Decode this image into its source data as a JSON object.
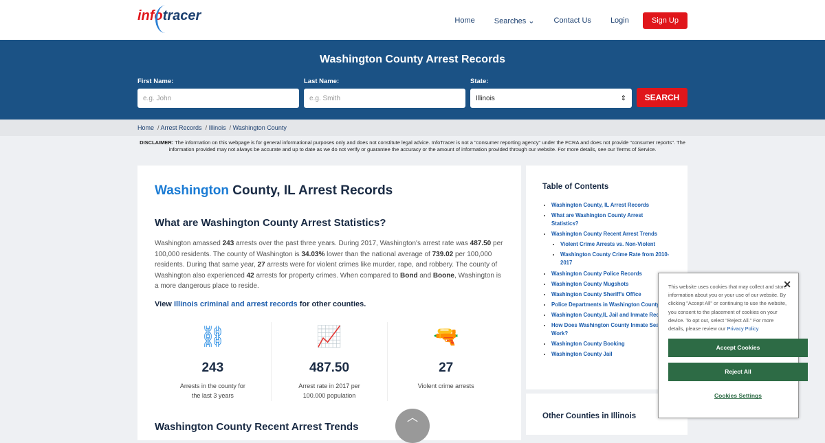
{
  "header": {
    "logo": "infotracer",
    "nav": [
      "Home",
      "Searches",
      "Contact Us",
      "Login"
    ],
    "signup": "Sign Up"
  },
  "hero": {
    "title": "Washington County Arrest Records",
    "first_label": "First Name:",
    "first_placeholder": "e.g. John",
    "last_label": "Last Name:",
    "last_placeholder": "e.g. Smith",
    "state_label": "State:",
    "state_value": "Illinois",
    "search": "SEARCH"
  },
  "breadcrumb": [
    "Home",
    "Arrest Records",
    "Illinois",
    "Washington County"
  ],
  "disclaimer": {
    "label": "DISCLAIMER:",
    "text": " The information on this webpage is for general informational purposes only and does not constitute legal advice. InfoTracer is not a \"consumer reporting agency\" under the FCRA and does not provide \"consumer reports\". The information provided may not always be accurate and up to date as we do not verify or guarantee the accuracy or the amount of information provided through our website. For more details, see our ",
    "link": "Terms of Service",
    "end": "."
  },
  "main": {
    "title_a": "Washington",
    "title_b": " County, IL Arrest Records",
    "h3": "What are Washington County Arrest Statistics?",
    "p": [
      "Washington amassed ",
      "243",
      " arrests over the past three years. During 2017, Washington's arrest rate was ",
      "487.50",
      " per 100,000 residents. The county of Washington is ",
      "34.03%",
      " lower than the national average of ",
      "739.02",
      " per 100,000 residents. During that same year, ",
      "27",
      " arrests were for violent crimes like murder, rape, and robbery. The county of Washington also experienced ",
      "42",
      " arrests for property crimes. When compared to ",
      "Bond",
      " and ",
      "Boone",
      ", Washington is a more dangerous place to reside."
    ],
    "view_a": "View ",
    "view_link": "Illinois criminal and arrest records",
    "view_b": " for other counties.",
    "stats": [
      {
        "icon": "handcuffs-icon",
        "value": "243",
        "label": "Arrests in the county for the last 3 years"
      },
      {
        "icon": "trend-chart-icon",
        "value": "487.50",
        "label": "Arrest rate in 2017 per 100.000 population"
      },
      {
        "icon": "gun-icon",
        "value": "27",
        "label": "Violent crime arrests"
      }
    ],
    "next_heading": "Washington County Recent Arrest Trends"
  },
  "toc": {
    "title": "Table of Contents",
    "items": [
      "Washington County, IL Arrest Records",
      "What are Washington County Arrest Statistics?",
      "Washington County Recent Arrest Trends",
      "Violent Crime Arrests vs. Non-Violent",
      "Washington County Crime Rate from 2010-2017",
      "Washington County Police Records",
      "Washington County Mugshots",
      "Washington County Sheriff's Office",
      "Police Departments in Washington County",
      "Washington County,IL Jail and Inmate Records",
      "How Does Washington County Inmate Search Work?",
      "Washington County Booking",
      "Washington County Jail"
    ]
  },
  "other": {
    "title": "Other Counties in Illinois"
  },
  "cookie": {
    "text": "This website uses cookies that may collect and store information about you or your use of our website. By clicking \"Accept All\" or continuing to use the website, you consent to the placement of cookies on your device. To opt out, select \"Reject All.\" For more details, please review our ",
    "link": "Privacy Policy",
    "accept": "Accept Cookies",
    "reject": "Reject All",
    "settings": "Cookies Settings"
  }
}
